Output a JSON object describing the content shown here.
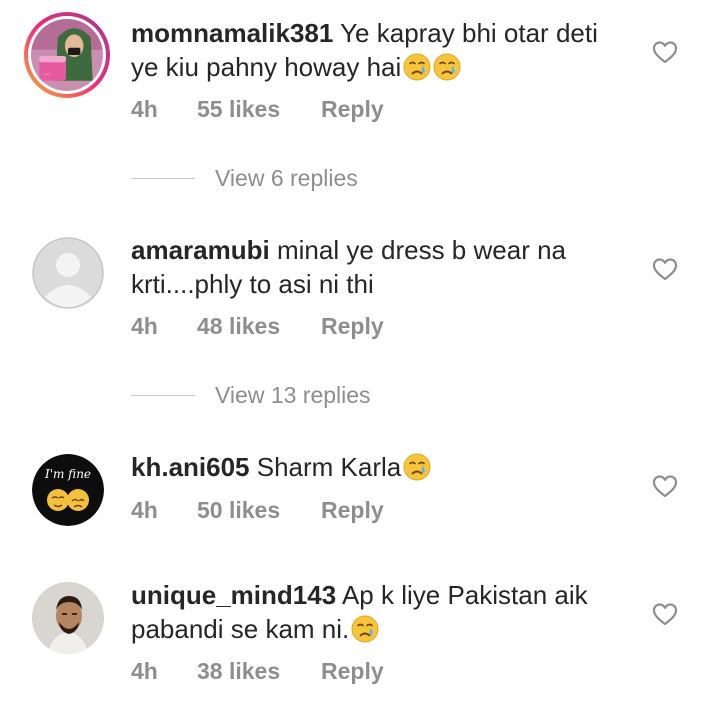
{
  "comments": [
    {
      "username": "momnamalik381",
      "text": "Ye kapray bhi otar deti ye kiu pahny howay hai",
      "emojis": [
        "crying-face",
        "crying-face"
      ],
      "time": "4h",
      "likes": "55 likes",
      "reply": "Reply",
      "view_replies": "View 6 replies"
    },
    {
      "username": "amaramubi",
      "text": "minal ye dress b wear na krti....phly to asi ni thi",
      "emojis": [],
      "time": "4h",
      "likes": "48 likes",
      "reply": "Reply",
      "view_replies": "View 13 replies"
    },
    {
      "username": "kh.ani605",
      "text": "Sharm Karla",
      "emojis": [
        "crying-face"
      ],
      "time": "4h",
      "likes": "50 likes",
      "reply": "Reply"
    },
    {
      "username": "unique_mind143",
      "text": "Ap k liye Pakistan aik pabandi se kam ni.",
      "emojis": [
        "crying-face"
      ],
      "time": "4h",
      "likes": "38 likes",
      "reply": "Reply"
    }
  ],
  "avatar_texts": {
    "kh_ani605": "I'm fine"
  },
  "colors": {
    "text": "#262626",
    "muted": "#8e8e8e",
    "story_ring_start": "#f9b233",
    "story_ring_end": "#c13584"
  }
}
